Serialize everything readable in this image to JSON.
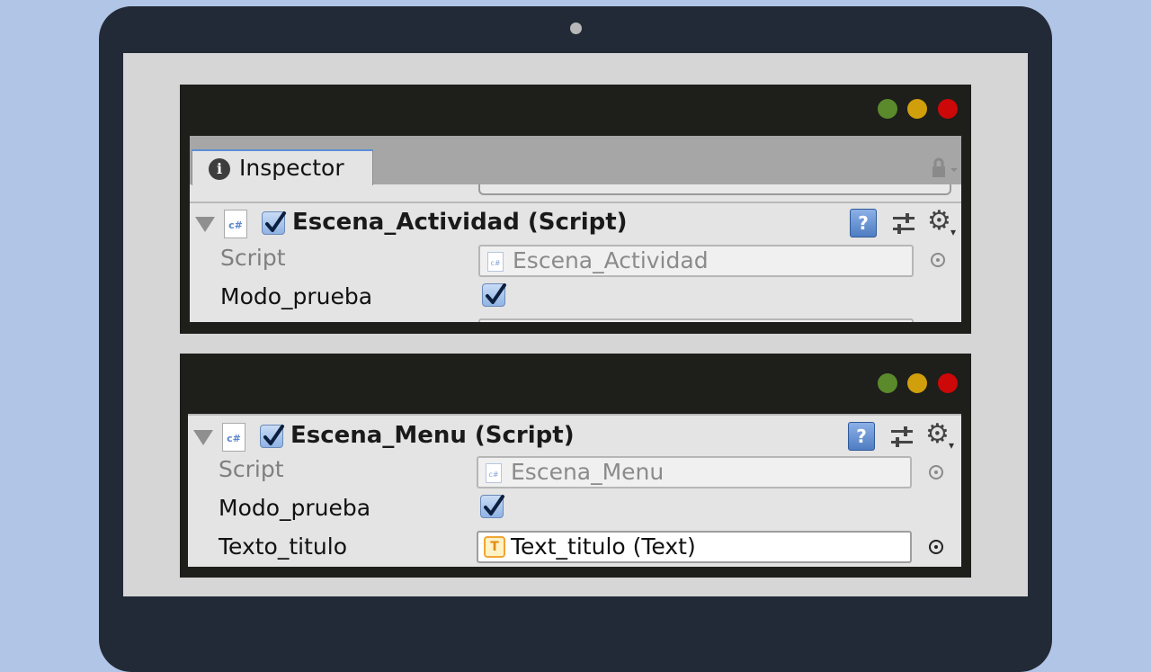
{
  "window_buttons": [
    "green",
    "yellow",
    "red"
  ],
  "colors": {
    "background": "#b1c5e6",
    "laptop_frame": "#232a37",
    "window_chrome": "#1e1e1b",
    "inspector_bg": "#e4e4e4",
    "dot_green": "#5a8a2b",
    "dot_yellow": "#d19e0c",
    "dot_red": "#cc0808"
  },
  "top_window": {
    "tab_label": "Inspector",
    "tab_icon": "info-icon",
    "component": {
      "title": "Escena_Actividad (Script)",
      "enabled": true,
      "icons": [
        "csharp-script-icon",
        "help-icon",
        "preset-icon",
        "gear-icon"
      ],
      "properties": [
        {
          "label": "Script",
          "value": "Escena_Actividad",
          "type": "object-field",
          "readonly": true
        },
        {
          "label": "Modo_prueba",
          "checked": true,
          "type": "checkbox"
        }
      ]
    }
  },
  "bottom_window": {
    "component": {
      "title": "Escena_Menu (Script)",
      "enabled": true,
      "icons": [
        "csharp-script-icon",
        "help-icon",
        "preset-icon",
        "gear-icon"
      ],
      "properties": [
        {
          "label": "Script",
          "value": "Escena_Menu",
          "type": "object-field",
          "readonly": true
        },
        {
          "label": "Modo_prueba",
          "checked": true,
          "type": "checkbox"
        },
        {
          "label": "Texto_titulo",
          "value": "Text_titulo (Text)",
          "type": "object-field",
          "readonly": false
        }
      ]
    }
  }
}
